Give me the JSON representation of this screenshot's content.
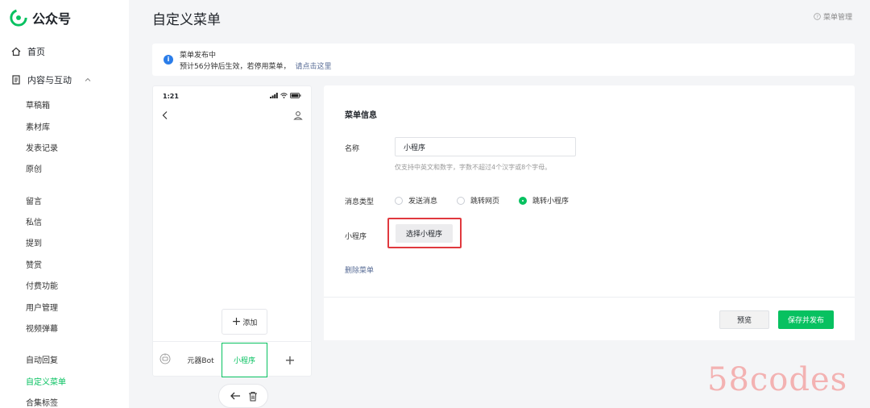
{
  "brand": {
    "name": "公众号",
    "color": "#07c160"
  },
  "sidebar": {
    "home": "首页",
    "content_group": "内容与互动",
    "items": [
      {
        "label": "草稿箱"
      },
      {
        "label": "素材库"
      },
      {
        "label": "发表记录"
      },
      {
        "label": "原创"
      },
      {
        "label": "留言"
      },
      {
        "label": "私信"
      },
      {
        "label": "提到"
      },
      {
        "label": "赞赏"
      },
      {
        "label": "付费功能"
      },
      {
        "label": "用户管理"
      },
      {
        "label": "视频弹幕"
      },
      {
        "label": "自动回复"
      },
      {
        "label": "自定义菜单",
        "active": true
      },
      {
        "label": "合集标签"
      }
    ]
  },
  "header": {
    "title": "自定义菜单",
    "help_label": "菜单管理",
    "help_icon": "question-circle-icon"
  },
  "notice": {
    "title": "菜单发布中",
    "description": "预计56分钟后生效，若停用菜单，",
    "link": "请点击这里"
  },
  "phone": {
    "time": "1:21",
    "add_label": "添加",
    "menu": {
      "bot_label": "元器Bot",
      "selected_label": "小程序",
      "add_symbol": "+"
    }
  },
  "editor": {
    "title": "菜单信息",
    "name_label": "名称",
    "name_value": "小程序",
    "name_hint": "仅支持中英文和数字，字数不超过4个汉字或8个字母。",
    "type_label": "消息类型",
    "types": [
      {
        "label": "发送消息",
        "selected": false
      },
      {
        "label": "跳转网页",
        "selected": false
      },
      {
        "label": "跳转小程序",
        "selected": true
      }
    ],
    "miniprogram_label": "小程序",
    "select_button": "选择小程序",
    "delete_link": "删除菜单"
  },
  "footer": {
    "preview": "预览",
    "save_publish": "保存并发布"
  },
  "watermark": "58codes",
  "colors": {
    "accent": "#07c160",
    "link": "#576b95",
    "info": "#2b7de9",
    "highlight": "#e0393e"
  }
}
